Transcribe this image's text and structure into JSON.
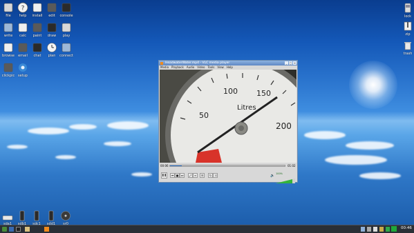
{
  "desktop": {
    "icons_col1": [
      {
        "label": "file",
        "icon": "folder-icon"
      },
      {
        "label": "write",
        "icon": "write-icon"
      },
      {
        "label": "browse",
        "icon": "browse-icon"
      },
      {
        "label": "clickpic",
        "icon": "clickpic-icon"
      }
    ],
    "icons_row1": [
      {
        "label": "file",
        "icon": "file-icon"
      },
      {
        "label": "help",
        "icon": "help-icon"
      },
      {
        "label": "install",
        "icon": "install-icon"
      },
      {
        "label": "edit",
        "icon": "edit-icon"
      },
      {
        "label": "console",
        "icon": "console-icon"
      }
    ],
    "icons_row2": [
      {
        "label": "write",
        "icon": "write-icon"
      },
      {
        "label": "calc",
        "icon": "calc-icon"
      },
      {
        "label": "paint",
        "icon": "paint-icon"
      },
      {
        "label": "draw",
        "icon": "draw-icon"
      },
      {
        "label": "play",
        "icon": "play-icon"
      }
    ],
    "icons_row3": [
      {
        "label": "browse",
        "icon": "globe-icon"
      },
      {
        "label": "email",
        "icon": "email-icon"
      },
      {
        "label": "chat",
        "icon": "chat-icon"
      },
      {
        "label": "plan",
        "icon": "clock-icon"
      },
      {
        "label": "connect",
        "icon": "connect-icon"
      }
    ],
    "icons_row4": [
      {
        "label": "clickpic",
        "icon": "clickpic-icon"
      },
      {
        "label": "setup",
        "icon": "gear-icon"
      }
    ],
    "right_icons": [
      {
        "label": "lock",
        "icon": "lock-icon"
      },
      {
        "label": "zip",
        "icon": "zip-icon"
      },
      {
        "label": "trash",
        "icon": "trash-icon"
      }
    ],
    "drives": [
      {
        "label": "sda1",
        "icon": "drive-icon"
      },
      {
        "label": "sdb1",
        "icon": "usb-drive-icon"
      },
      {
        "label": "sdc1",
        "icon": "usb-drive-icon"
      },
      {
        "label": "sdd1",
        "icon": "usb-drive-icon"
      },
      {
        "label": "sr0",
        "icon": "optical-drive-icon"
      }
    ]
  },
  "vlc": {
    "title": "HeadwaterWater.mp4 - VLC media player",
    "menu": [
      "Media",
      "Playback",
      "Audio",
      "Video",
      "Tools",
      "View",
      "Help"
    ],
    "time_elapsed": "00:06",
    "time_total": "01:02",
    "volume": "100%",
    "seek_progress": 0.1,
    "gauge": {
      "unit": "Litres",
      "ticks": [
        "50",
        "100",
        "150",
        "200"
      ]
    }
  },
  "taskbar": {
    "clock": "00:46"
  },
  "colors": {
    "sky_top": "#0a3d8f",
    "horizon": "#7fbcf0",
    "taskbar": "#2a2f36",
    "vlc_title": "#5f88c4",
    "volume_green": "#36b43a"
  }
}
